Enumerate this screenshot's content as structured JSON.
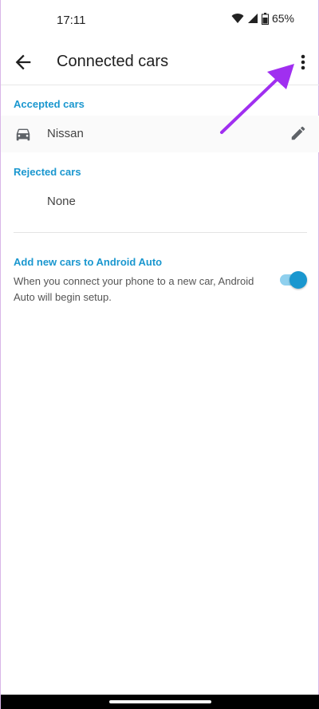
{
  "status_bar": {
    "time": "17:11",
    "battery": "65%",
    "icons": [
      "wifi-icon",
      "signal-icon",
      "battery-icon"
    ]
  },
  "app_bar": {
    "title": "Connected cars",
    "back_icon": "arrow-left-icon",
    "overflow_icon": "more-vert-icon"
  },
  "accepted": {
    "header": "Accepted cars",
    "cars": [
      {
        "name": "Nissan",
        "icon": "car-icon",
        "action_icon": "pencil-icon"
      }
    ]
  },
  "rejected": {
    "header": "Rejected cars",
    "empty_text": "None"
  },
  "add_new": {
    "title": "Add new cars to Android Auto",
    "description": "When you connect your phone to a new car, Android Auto will begin setup.",
    "enabled": true
  },
  "colors": {
    "accent": "#1a97cf",
    "toggle_track": "#8fd0ee",
    "annotation_arrow": "#a02ff0"
  }
}
